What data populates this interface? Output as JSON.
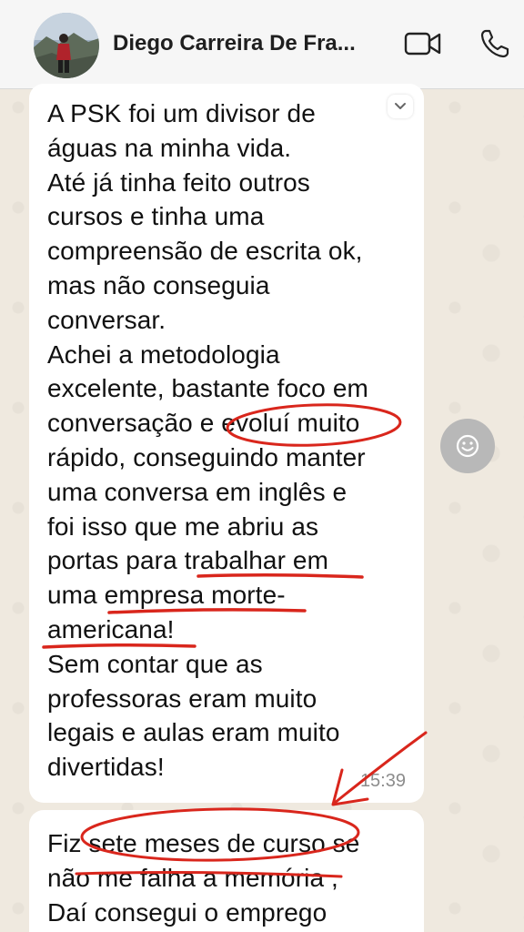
{
  "header": {
    "contact_name": "Diego Carreira De Fra..."
  },
  "messages": [
    {
      "text": "A PSK foi um divisor de\náguas na minha vida.\nAté já tinha feito outros\ncursos e tinha uma\ncompreensão de escrita ok,\nmas não conseguia\nconversar.\nAchei a metodologia\nexcelente, bastante foco em\nconversação e evoluí muito\nrápido, conseguindo manter\numa conversa em inglês e\nfoi isso que me abriu as\nportas para trabalhar em\numa empresa morte-\namericana!\nSem contar que as\nprofessoras eram muito\nlegais e aulas eram muito\ndivertidas!",
      "time": "15:39"
    },
    {
      "text": "Fiz sete meses de curso se\nnão me falha a memória ,\nDaí consegui o emprego"
    }
  ],
  "colors": {
    "annotation_red": "#d9261c",
    "bubble": "#ffffff",
    "chat_background": "#efe9df"
  },
  "icons": [
    "video-call-icon",
    "phone-icon",
    "chevron-down-icon",
    "smiley-icon",
    "arrow-annotation"
  ]
}
